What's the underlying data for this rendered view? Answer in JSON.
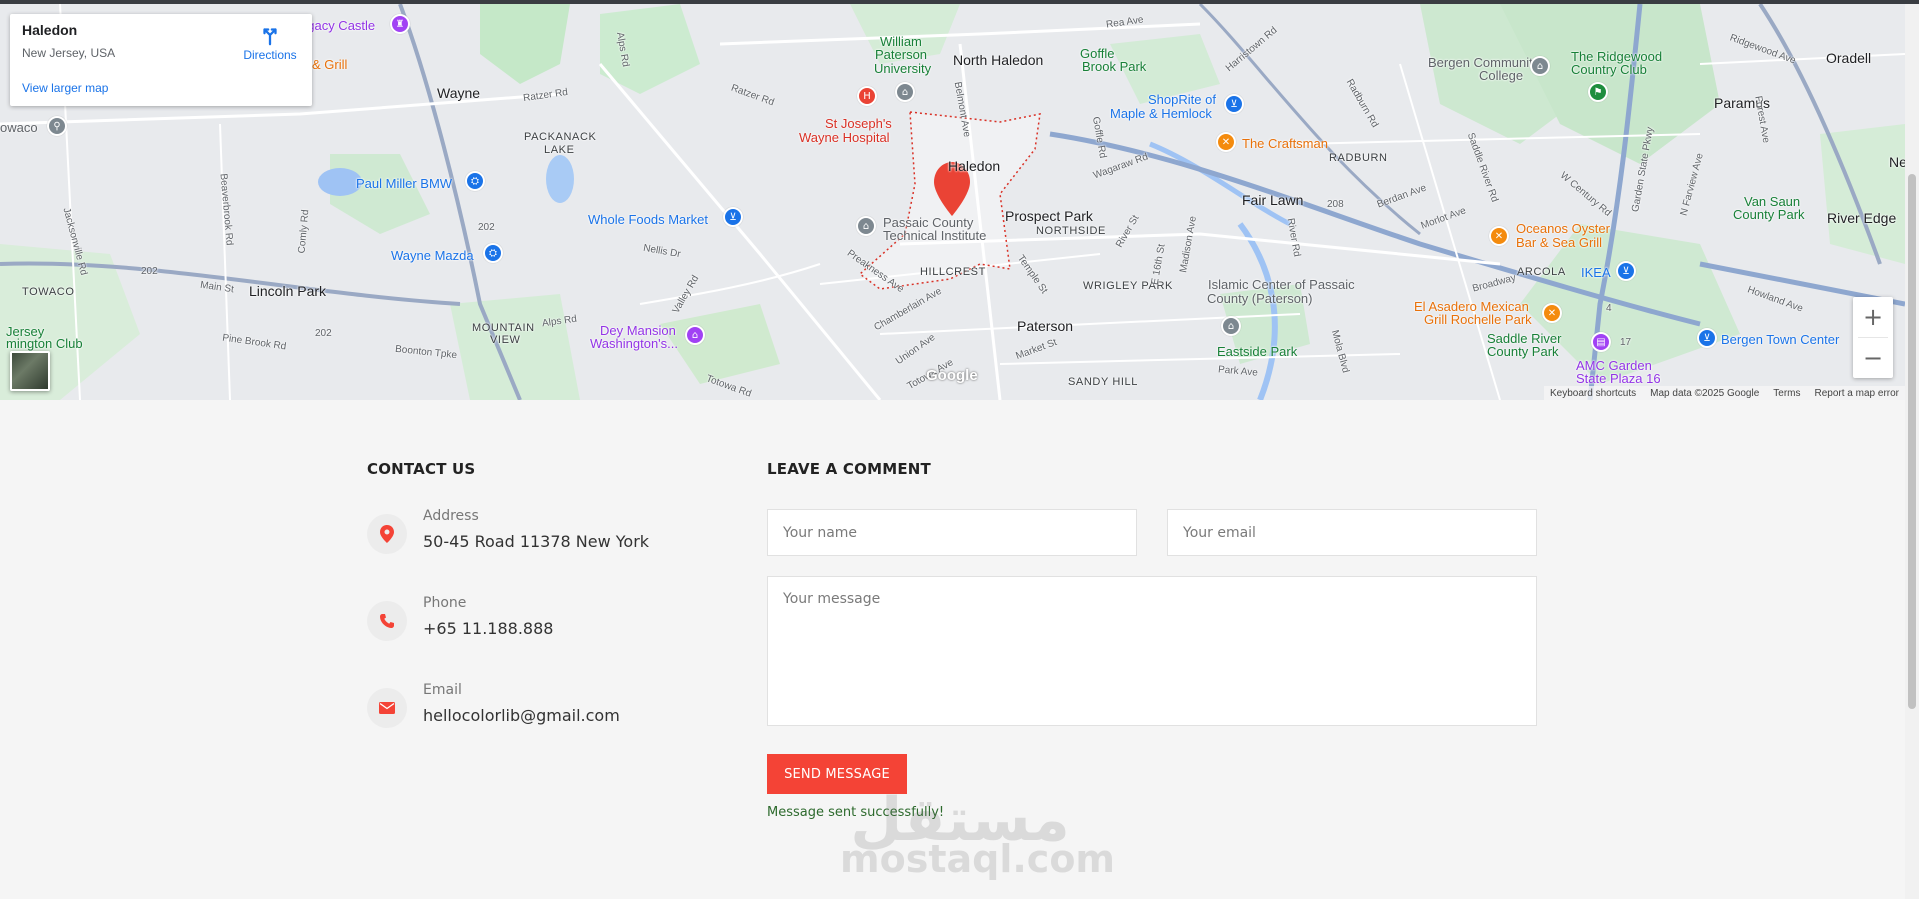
{
  "map": {
    "info_card": {
      "place": "Haledon",
      "region": "New Jersey, USA",
      "directions_label": "Directions",
      "larger_map_label": "View larger map"
    },
    "labels": {
      "legacy_castle": "egacy Castle",
      "grill": "& Grill",
      "towaco_top": "owaco",
      "wayne": "Wayne",
      "ratzer_rd_1": "Ratzer Rd",
      "ratzer_rd_2": "Ratzer Rd",
      "alps_rd_top": "Alps Rd",
      "packanack": "PACKANACK",
      "lake": "LAKE",
      "paul_miller": "Paul Miller BMW",
      "whole_foods": "Whole Foods Market",
      "wayne_mazda": "Wayne Mazda",
      "towaco": "TOWACO",
      "lincoln_park": "Lincoln Park",
      "main_st": "Main St",
      "pine_brook": "Pine Brook Rd",
      "boonton": "Boonton Tpke",
      "mountain_view_1": "MOUNTAIN",
      "mountain_view_2": "VIEW",
      "alps_rd": "Alps Rd",
      "jersey_club_1": "Jersey",
      "jersey_club_2": "mington Club",
      "dey_mansion_1": "Dey Mansion",
      "dey_mansion_2": "Washington's...",
      "nellis_dr": "Nellis Dr",
      "valley_rd": "Valley Rd",
      "william_paterson_1": "William",
      "william_paterson_2": "Paterson",
      "william_paterson_3": "University",
      "st_josephs_1": "St Joseph's",
      "st_josephs_2": "Wayne Hospital",
      "north_haledon": "North Haledon",
      "belmont_ave": "Belmont Ave",
      "haledon": "Haledon",
      "passaic_1": "Passaic County",
      "passaic_2": "Technical Institute",
      "prospect_park": "Prospect Park",
      "northside": "NORTHSIDE",
      "hillcrest": "HILLCREST",
      "preakness": "Preakness Ave",
      "chamberlain": "Chamberlain Ave",
      "union_ave": "Union Ave",
      "totowa_ave": "Totowa Ave",
      "totowa_rd": "Totowa Rd",
      "paterson": "Paterson",
      "market_st": "Market St",
      "sandy_hill": "SANDY HILL",
      "temple_st": "Temple St",
      "wrigley_park": "WRIGLEY PARK",
      "goffle_1": "Goffle",
      "goffle_2": "Brook Park",
      "rea_ave": "Rea Ave",
      "goffle_rd": "Goffle Rd",
      "wagaraw": "Wagaraw Rd",
      "shoprite_1": "ShopRite of",
      "shoprite_2": "Maple & Hemlock",
      "craftsman": "The Craftsman",
      "radburn": "RADBURN",
      "fair_lawn": "Fair Lawn",
      "river_rd": "River Rd",
      "e16th": "E 16th St",
      "madison": "Madison Ave",
      "river_st": "River St",
      "islamic_1": "Islamic Center of Passaic",
      "islamic_2": "County (Paterson)",
      "eastside": "Eastside Park",
      "park_ave": "Park Ave",
      "mola_blvd": "Mola Blvd",
      "harristown": "Harristown Rd",
      "radburn_rd": "Radburn Rd",
      "bergen_cc_1": "Bergen Community",
      "bergen_cc_2": "College",
      "ridgewood_1": "The Ridgewood",
      "ridgewood_2": "Country Club",
      "ridgewood_ave": "Ridgewood Ave",
      "paramus": "Paramus",
      "oradell": "Oradell",
      "berdan": "Berdan Ave",
      "morlot": "Morlot Ave",
      "saddle_river_rd": "Saddle River Rd",
      "w_century": "W Century Rd",
      "garden_state": "Garden State Pkwy",
      "oceanos_1": "Oceanos Oyster",
      "oceanos_2": "Bar & Sea Grill",
      "arcola": "ARCOLA",
      "ikea": "IKEA",
      "broadway": "Broadway",
      "el_asadero_1": "El Asadero Mexican",
      "el_asadero_2": "Grill Rochelle Park",
      "saddle_river_park_1": "Saddle River",
      "saddle_river_park_2": "County Park",
      "amc_1": "AMC Garden",
      "amc_2": "State Plaza 16",
      "bergen_town": "Bergen Town Center",
      "howland": "Howland Ave",
      "van_saun_1": "Van Saun",
      "van_saun_2": "County Park",
      "river_edge": "River Edge",
      "n_farview": "N Farview Ave",
      "forest_ave": "Forest Ave",
      "ne": "Ne",
      "jacksonville": "Jacksonville Rd",
      "beavertown": "Beaverbrook Rd",
      "comly": "Comly Rd",
      "rt202_a": "202",
      "rt202_b": "202",
      "rt202_c": "202",
      "rt208": "208",
      "rt4": "4",
      "rt17": "17"
    },
    "google_logo": "Google",
    "footer": {
      "shortcuts": "Keyboard shortcuts",
      "data": "Map data ©2025 Google",
      "terms": "Terms",
      "report": "Report a map error"
    },
    "zoom_in": "+",
    "zoom_out": "−"
  },
  "contact": {
    "title": "CONTACT US",
    "items": [
      {
        "label": "Address",
        "value": "50-45 Road 11378 New York",
        "icon": "location-pin-icon"
      },
      {
        "label": "Phone",
        "value": "+65 11.188.888",
        "icon": "phone-icon"
      },
      {
        "label": "Email",
        "value": "hellocolorlib@gmail.com",
        "icon": "envelope-icon"
      }
    ]
  },
  "comment": {
    "title": "LEAVE A COMMENT",
    "name_placeholder": "Your name",
    "email_placeholder": "Your email",
    "message_placeholder": "Your message",
    "send_label": "SEND MESSAGE",
    "success_text": "Message sent successfully!"
  },
  "watermark": {
    "arabic": "مستقل",
    "latin": "mostaql.com"
  },
  "colors": {
    "accent": "#f44336",
    "success": "#2d6a2d",
    "map_link": "#1a73e8"
  }
}
